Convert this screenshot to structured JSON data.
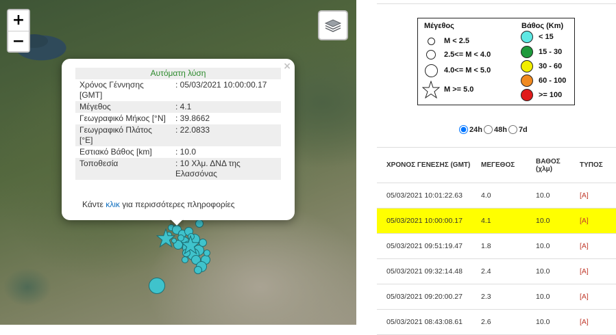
{
  "map": {
    "zoom_in": "+",
    "zoom_out": "−",
    "layers_icon": "layers-icon",
    "popup": {
      "heading": "Αυτόματη λύση",
      "close": "×",
      "rows": [
        {
          "label": "Χρόνος Γέννησης [GMT]",
          "value": ": 05/03/2021 10:00:00.17"
        },
        {
          "label": "Μέγεθος",
          "value": ": 4.1"
        },
        {
          "label": "Γεωγραφικό Μήκος [°N]",
          "value": ": 39.8662"
        },
        {
          "label": "Γεωγραφικό Πλάτος [°E]",
          "value": ": 22.0833"
        },
        {
          "label": "Εστιακό Βάθος [km]",
          "value": ": 10.0"
        },
        {
          "label": "Τοποθεσία",
          "value": ": 10 Χλμ. ΔΝΔ της Ελασσόνας"
        }
      ],
      "more_prefix": "Κάντε ",
      "more_link": "κλικ",
      "more_suffix": " για περισσότερες πληροφορίες"
    }
  },
  "legend": {
    "magnitude_title": "Μέγεθος",
    "depth_title": "Βάθος (Km)",
    "magnitudes": [
      "M < 2.5",
      "2.5<= M < 4.0",
      "4.0<= M < 5.0",
      "M >= 5.0"
    ],
    "depths": [
      {
        "label": "< 15",
        "color": "#5ee8e3"
      },
      {
        "label": "15 - 30",
        "color": "#1e9a3c"
      },
      {
        "label": "30 - 60",
        "color": "#f2ee00"
      },
      {
        "label": "60 - 100",
        "color": "#f08a20"
      },
      {
        "label": ">= 100",
        "color": "#e01b1b"
      }
    ]
  },
  "range": {
    "options": [
      "24h",
      "48h",
      "7d"
    ],
    "selected": "24h"
  },
  "events": {
    "headers": [
      "ΧΡΟΝΟΣ ΓΕΝΕΣΗΣ (GMT)",
      "ΜΕΓΕΘΟΣ",
      "ΒΑΘΟΣ (χλμ)",
      "ΤΥΠΟΣ"
    ],
    "rows": [
      {
        "time": "05/03/2021 10:01:22.63",
        "mag": "4.0",
        "depth": "10.0",
        "type": "[A]"
      },
      {
        "time": "05/03/2021 10:00:00.17",
        "mag": "4.1",
        "depth": "10.0",
        "type": "[A]",
        "selected": true
      },
      {
        "time": "05/03/2021 09:51:19.47",
        "mag": "1.8",
        "depth": "10.0",
        "type": "[A]"
      },
      {
        "time": "05/03/2021 09:32:14.48",
        "mag": "2.4",
        "depth": "10.0",
        "type": "[A]"
      },
      {
        "time": "05/03/2021 09:20:00.27",
        "mag": "2.3",
        "depth": "10.0",
        "type": "[A]"
      },
      {
        "time": "05/03/2021 08:43:08.61",
        "mag": "2.6",
        "depth": "10.0",
        "type": "[A]"
      }
    ]
  },
  "colors": {
    "quake_fill": "#3fc3cc",
    "selected_row": "#ffff00",
    "popup_heading": "#2b8a2b"
  }
}
